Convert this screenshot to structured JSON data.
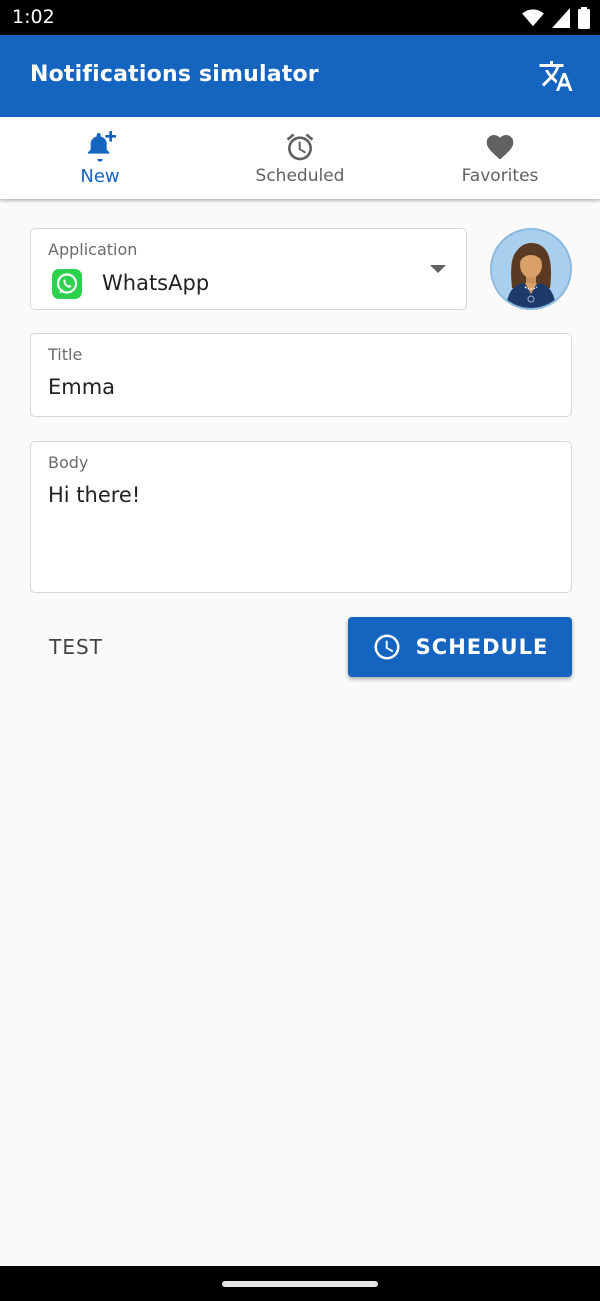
{
  "status_bar": {
    "time": "1:02"
  },
  "app_bar": {
    "title": "Notifications simulator",
    "translate_icon": "translate-icon"
  },
  "tabs": [
    {
      "label": "New",
      "icon": "bell-plus-icon",
      "active": true
    },
    {
      "label": "Scheduled",
      "icon": "alarm-clock-icon",
      "active": false
    },
    {
      "label": "Favorites",
      "icon": "heart-icon",
      "active": false
    }
  ],
  "form": {
    "application": {
      "label": "Application",
      "value": "WhatsApp",
      "icon": "whatsapp-icon"
    },
    "title": {
      "label": "Title",
      "value": "Emma"
    },
    "body": {
      "label": "Body",
      "value": "Hi there!"
    }
  },
  "actions": {
    "test_label": "TEST",
    "schedule_label": "SCHEDULE"
  },
  "colors": {
    "primary": "#1565c0",
    "whatsapp": "#2cd14d",
    "background": "#fafafa"
  }
}
